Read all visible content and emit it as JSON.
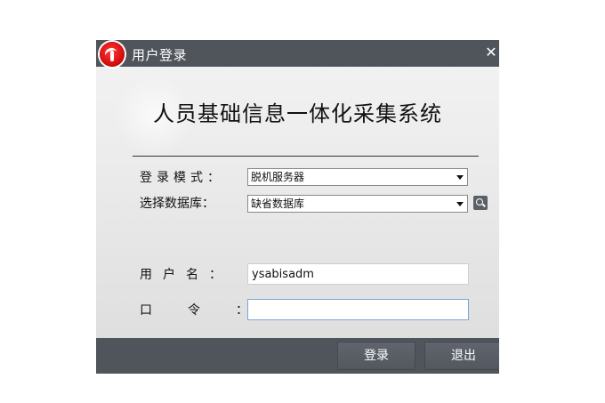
{
  "window": {
    "title": "用户登录",
    "close_label": "✕",
    "logo_icon": "app-logo-icon"
  },
  "header": {
    "system_title": "人员基础信息一体化采集系统"
  },
  "form": {
    "login_mode": {
      "label": "登录模式：",
      "selected": "脱机服务器"
    },
    "database": {
      "label": "选择数据库：",
      "selected": "缺省数据库",
      "search_icon": "search-icon"
    },
    "username": {
      "label": "用户名：",
      "value": "ysabisadm"
    },
    "password": {
      "label": "口令：",
      "value": ""
    }
  },
  "actions": {
    "login_label": "登录",
    "exit_label": "退出"
  },
  "colors": {
    "title_bar": "#50555c",
    "logo_red": "#d60f0f",
    "focus_border": "#7aa7d9"
  }
}
